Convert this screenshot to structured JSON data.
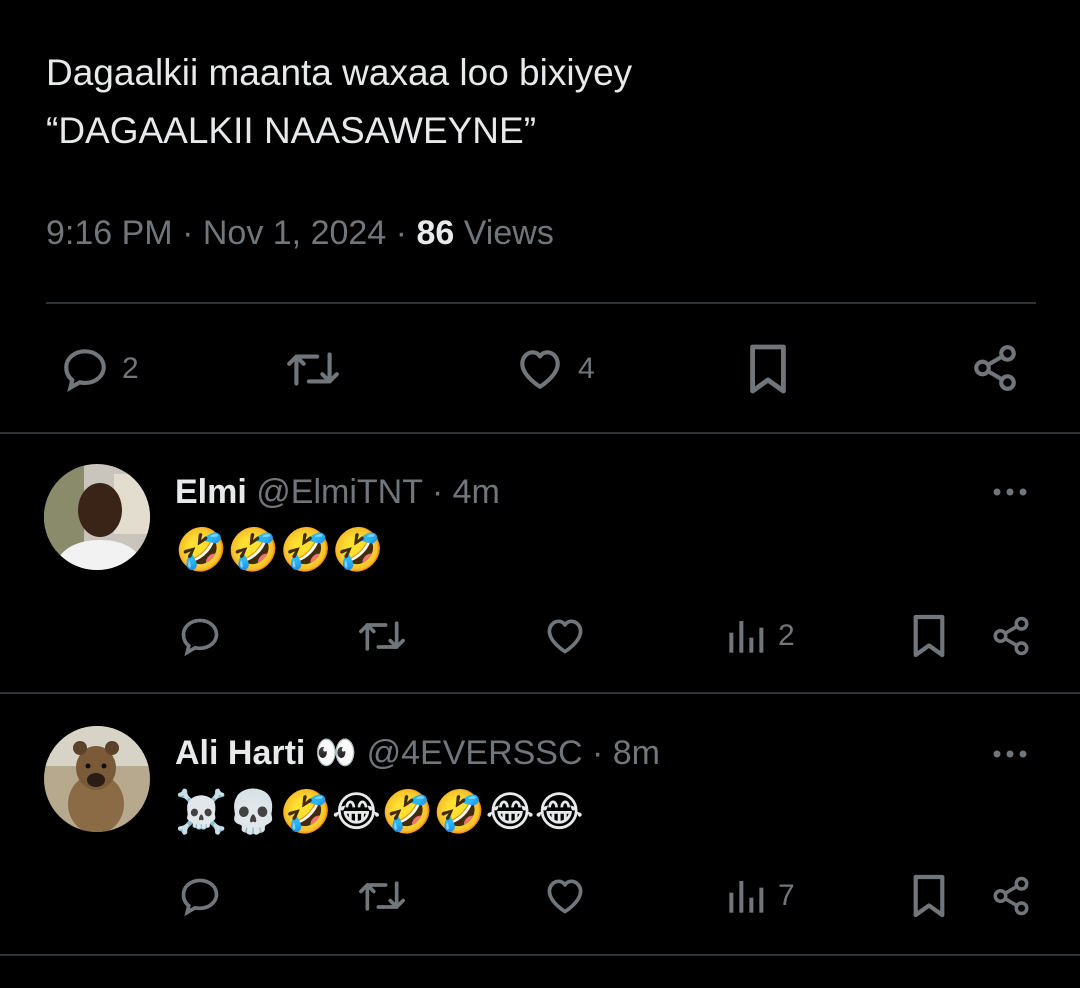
{
  "tweet": {
    "lines": [
      "Dagaalkii maanta waxaa loo bixiyey",
      "“DAGAALKII NAASAWEYNE”"
    ],
    "time": "9:16 PM",
    "date": "Nov 1, 2024",
    "views_count": "86",
    "views_label": "Views",
    "sep": "·",
    "actions": {
      "reply_count": "2",
      "like_count": "4"
    }
  },
  "replies": [
    {
      "name": "Elmi",
      "handle": "@ElmiTNT",
      "sep": "·",
      "time": "4m",
      "text": "🤣🤣🤣🤣",
      "views": "2"
    },
    {
      "name": "Ali Harti",
      "name_emoji": "👀",
      "handle": "@4EVERSSC",
      "sep": "·",
      "time": "8m",
      "text": "☠️💀🤣😂🤣🤣😂😂",
      "views": "7"
    }
  ],
  "colors": {
    "background": "#000000",
    "text": "#e7e9ea",
    "muted": "#71767b",
    "divider": "#2f3336"
  }
}
